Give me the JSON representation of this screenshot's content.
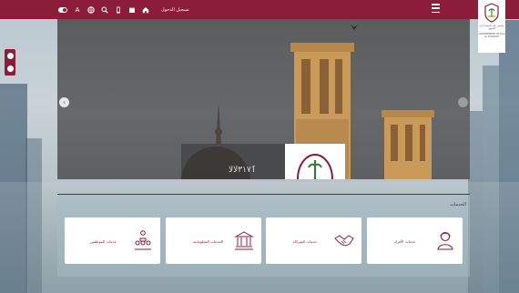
{
  "header": {
    "login_label": "تسجيل الدخول",
    "accessibility_label": "A",
    "colors": {
      "brand": "#8b1d3a"
    }
  },
  "logo": {
    "caption_ar": "حكومة رأس الخيمة دائرة الشؤون",
    "caption_en": "GOVERNMENT OF RAS AL KHAIMAH"
  },
  "hero": {
    "card_text": "ٱ٣١٧ﻻﻻ"
  },
  "services": {
    "title": "الخدمات",
    "cards": [
      {
        "label": "خدمات الموظفين",
        "icon": "employees-icon"
      },
      {
        "label": "الخدمات المعلوماتية",
        "icon": "institution-icon"
      },
      {
        "label": "خدمات الشركاء",
        "icon": "handshake-icon"
      },
      {
        "label": "خدمات الأفراد",
        "icon": "person-icon"
      }
    ]
  }
}
